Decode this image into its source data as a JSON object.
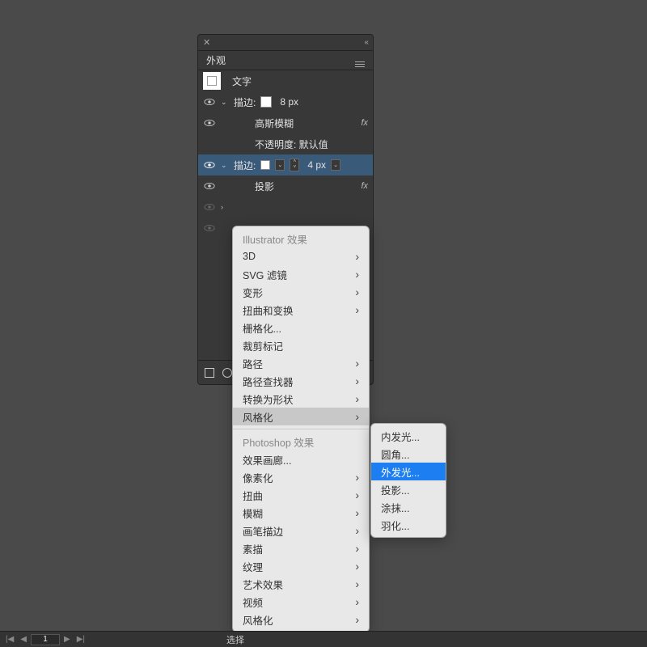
{
  "panel": {
    "title": "外观",
    "object_label": "文字",
    "rows": [
      {
        "label": "描边:",
        "value": "8 px"
      },
      {
        "label": "高斯模糊",
        "fx": true
      },
      {
        "label": "不透明度: 默认值"
      },
      {
        "label": "描边:",
        "value": "4 px",
        "selected": true
      },
      {
        "label": "投影",
        "fx": true
      }
    ]
  },
  "menu_main": {
    "header1": "Illustrator 效果",
    "items1": [
      {
        "label": "3D",
        "sub": true
      },
      {
        "label": "SVG 滤镜",
        "sub": true
      },
      {
        "label": "变形",
        "sub": true
      },
      {
        "label": "扭曲和变换",
        "sub": true
      },
      {
        "label": "栅格化..."
      },
      {
        "label": "裁剪标记"
      },
      {
        "label": "路径",
        "sub": true
      },
      {
        "label": "路径查找器",
        "sub": true
      },
      {
        "label": "转换为形状",
        "sub": true
      },
      {
        "label": "风格化",
        "sub": true,
        "highlight": true
      }
    ],
    "header2": "Photoshop 效果",
    "items2": [
      {
        "label": "效果画廊..."
      },
      {
        "label": "像素化",
        "sub": true
      },
      {
        "label": "扭曲",
        "sub": true
      },
      {
        "label": "模糊",
        "sub": true
      },
      {
        "label": "画笔描边",
        "sub": true
      },
      {
        "label": "素描",
        "sub": true
      },
      {
        "label": "纹理",
        "sub": true
      },
      {
        "label": "艺术效果",
        "sub": true
      },
      {
        "label": "视频",
        "sub": true
      },
      {
        "label": "风格化",
        "sub": true
      }
    ]
  },
  "menu_sub": {
    "items": [
      {
        "label": "内发光..."
      },
      {
        "label": "圆角..."
      },
      {
        "label": "外发光...",
        "selected": true
      },
      {
        "label": "投影..."
      },
      {
        "label": "涂抹..."
      },
      {
        "label": "羽化..."
      }
    ]
  },
  "bottom": {
    "page": "1",
    "mode": "选择"
  }
}
